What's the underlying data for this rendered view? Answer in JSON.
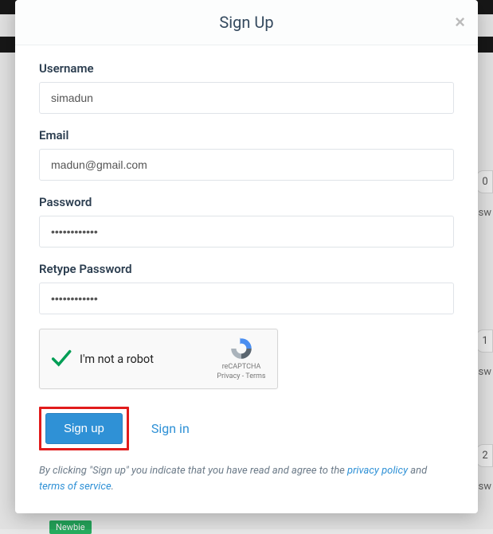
{
  "modal": {
    "title": "Sign Up",
    "close_label": "×"
  },
  "form": {
    "username": {
      "label": "Username",
      "value": "simadun"
    },
    "email": {
      "label": "Email",
      "value": "madun@gmail.com"
    },
    "password": {
      "label": "Password",
      "value": "••••••••••••"
    },
    "retype_password": {
      "label": "Retype Password",
      "value": "••••••••••••"
    }
  },
  "recaptcha": {
    "label": "I'm not a robot",
    "brand": "reCAPTCHA",
    "privacy": "Privacy",
    "terms": "Terms",
    "separator": " - "
  },
  "actions": {
    "signup": "Sign up",
    "signin": "Sign in"
  },
  "disclaimer": {
    "prefix": "By clicking \"Sign up\" you indicate that you have read and agree to the ",
    "privacy": "privacy policy",
    "middle": " and ",
    "terms": "terms of service",
    "suffix": "."
  },
  "background": {
    "counts": [
      "0",
      "1",
      "2"
    ],
    "nsw": "nsw"
  }
}
